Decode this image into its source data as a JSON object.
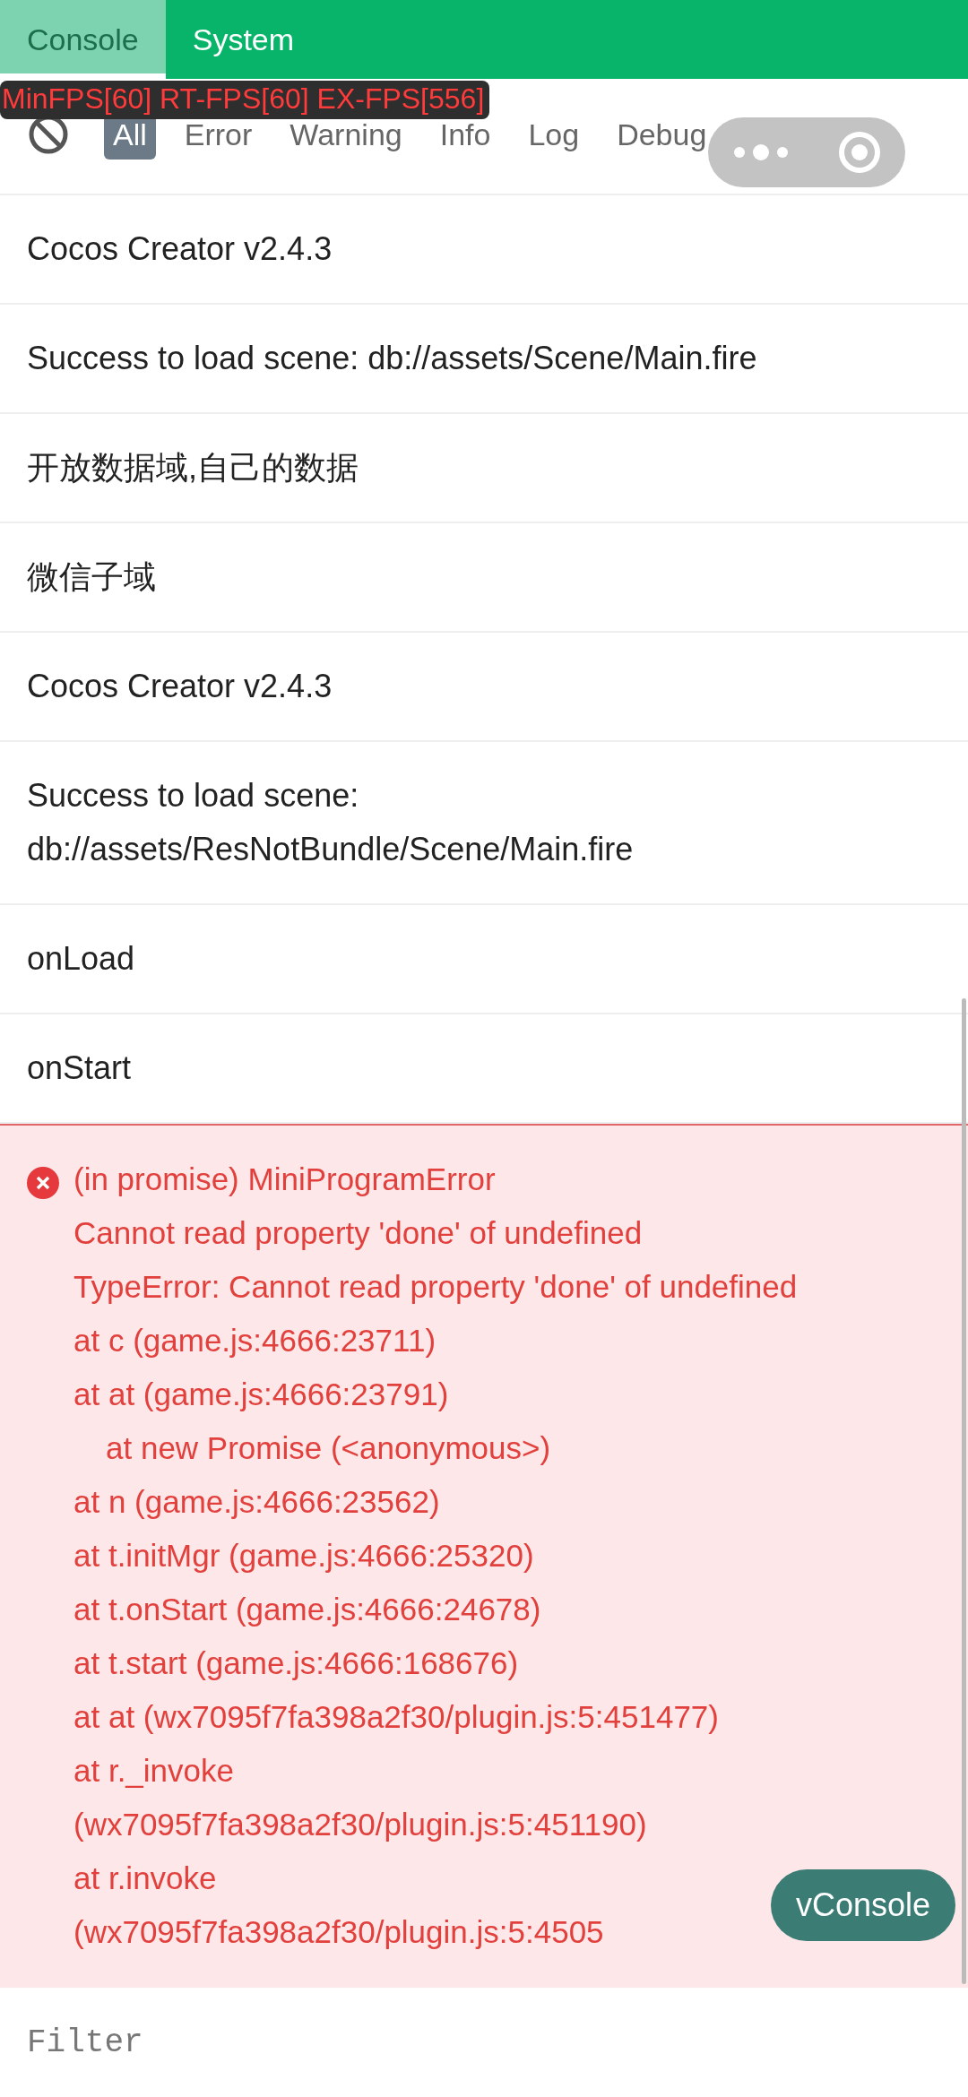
{
  "tabs": [
    {
      "label": "Console",
      "selected": true
    },
    {
      "label": "System",
      "selected": false
    }
  ],
  "fps_overlay": "MinFPS[60] RT-FPS[60] EX-FPS[556]",
  "filters": [
    {
      "label": "All",
      "selected": true
    },
    {
      "label": "Error",
      "selected": false
    },
    {
      "label": "Warning",
      "selected": false
    },
    {
      "label": "Info",
      "selected": false
    },
    {
      "label": "Log",
      "selected": false
    },
    {
      "label": "Debug",
      "selected": false
    }
  ],
  "logs": [
    {
      "kind": "log",
      "lines": [
        {
          "text": "Cocos Creator v2.4.3",
          "indented": false
        }
      ]
    },
    {
      "kind": "log",
      "lines": [
        {
          "text": "Success to load scene: db://assets/Scene/Main.fire",
          "indented": false
        }
      ]
    },
    {
      "kind": "log",
      "lines": [
        {
          "text": "开放数据域,自己的数据",
          "indented": false
        }
      ]
    },
    {
      "kind": "log",
      "lines": [
        {
          "text": "微信子域",
          "indented": false
        }
      ]
    },
    {
      "kind": "log",
      "lines": [
        {
          "text": "Cocos Creator v2.4.3",
          "indented": false
        }
      ]
    },
    {
      "kind": "log",
      "lines": [
        {
          "text": "Success to load scene: db://assets/ResNotBundle/Scene/Main.fire",
          "indented": false
        }
      ]
    },
    {
      "kind": "log",
      "lines": [
        {
          "text": "onLoad",
          "indented": false
        }
      ]
    },
    {
      "kind": "log",
      "lines": [
        {
          "text": "onStart",
          "indented": false
        }
      ]
    },
    {
      "kind": "error",
      "lines": [
        {
          "text": "(in promise) MiniProgramError",
          "indented": false
        },
        {
          "text": "Cannot read property 'done' of undefined",
          "indented": false
        },
        {
          "text": "TypeError: Cannot read property 'done' of undefined",
          "indented": false
        },
        {
          "text": "at c (game.js:4666:23711)",
          "indented": false
        },
        {
          "text": "at at (game.js:4666:23791)",
          "indented": false
        },
        {
          "text": "at new Promise (<anonymous>)",
          "indented": true
        },
        {
          "text": "at n (game.js:4666:23562)",
          "indented": false
        },
        {
          "text": "at t.initMgr (game.js:4666:25320)",
          "indented": false
        },
        {
          "text": "at t.onStart (game.js:4666:24678)",
          "indented": false
        },
        {
          "text": "at t.start (game.js:4666:168676)",
          "indented": false
        },
        {
          "text": "at at (wx7095f7fa398a2f30/plugin.js:5:451477)",
          "indented": false
        },
        {
          "text": "at r._invoke (wx7095f7fa398a2f30/plugin.js:5:451190)",
          "indented": false
        },
        {
          "text": "at r.invoke",
          "indented": false
        },
        {
          "text": "(wx7095f7fa398a2f30/plugin.js:5:4505",
          "indented": false
        }
      ]
    }
  ],
  "vconsole_button": "vConsole",
  "filter_input": {
    "placeholder": "Filter"
  }
}
